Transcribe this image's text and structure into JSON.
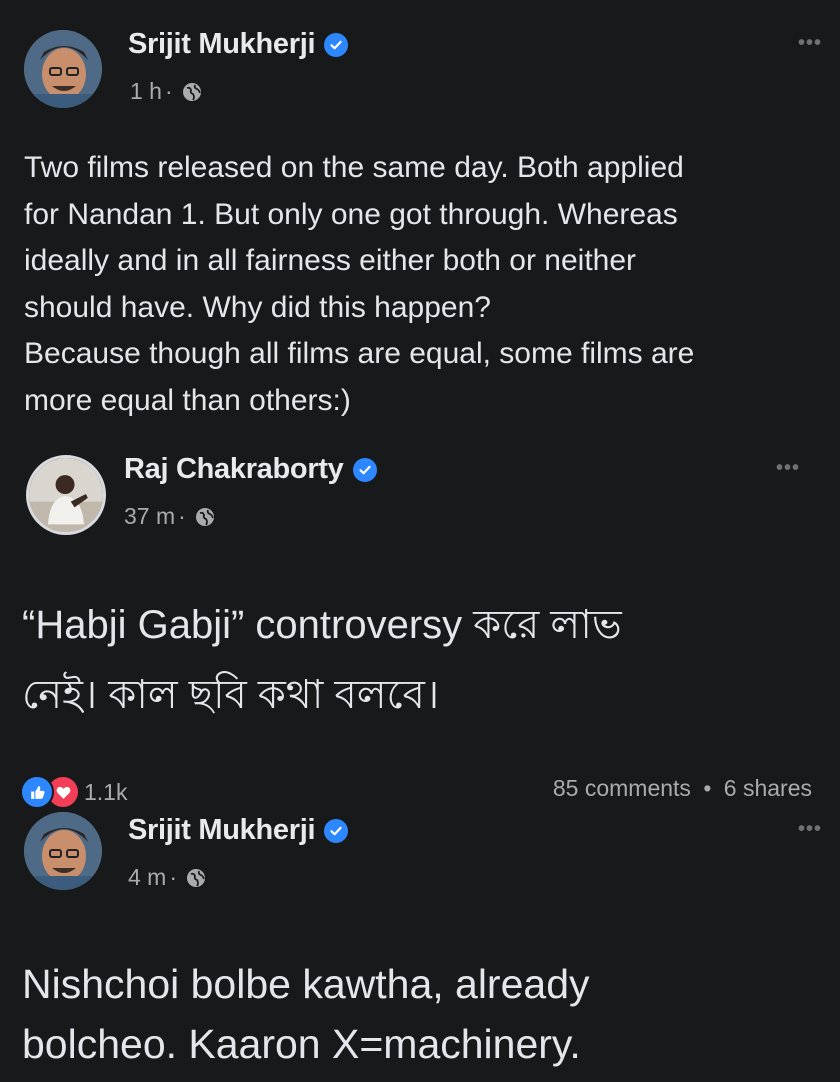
{
  "posts": [
    {
      "author": "Srijit Mukherji",
      "time": "1 h",
      "separator": "·",
      "more": "•••",
      "text": "Two films released on the same day. Both applied\nfor Nandan 1. But only one got through. Whereas\nideally and in all fairness either both or neither\nshould have. Why did this happen?\nBecause though all films are equal, some films are\nmore equal than others:)"
    },
    {
      "author": "Raj Chakraborty",
      "time": "37 m",
      "separator": "·",
      "more": "•••",
      "text": "“Habji Gabji” controversy করে লাভ\nনেই। কাল ছবি কথা বলবে।",
      "reaction_count": "1.1k",
      "comments": "85 comments",
      "shares": "6 shares",
      "stats_separator": "•"
    },
    {
      "author": "Srijit Mukherji",
      "time": "4 m",
      "separator": "·",
      "more": "•••",
      "text": "Nishchoi bolbe kawtha, already\nbolcheo. Kaaron X=machinery."
    }
  ],
  "icons": {
    "verified": "verified-badge-icon",
    "privacy": "globe-icon",
    "like": "like-icon",
    "love": "love-icon"
  },
  "colors": {
    "background": "#18191b",
    "verified": "#2d88ff",
    "like": "#2d88ff",
    "love": "#f33e58"
  }
}
